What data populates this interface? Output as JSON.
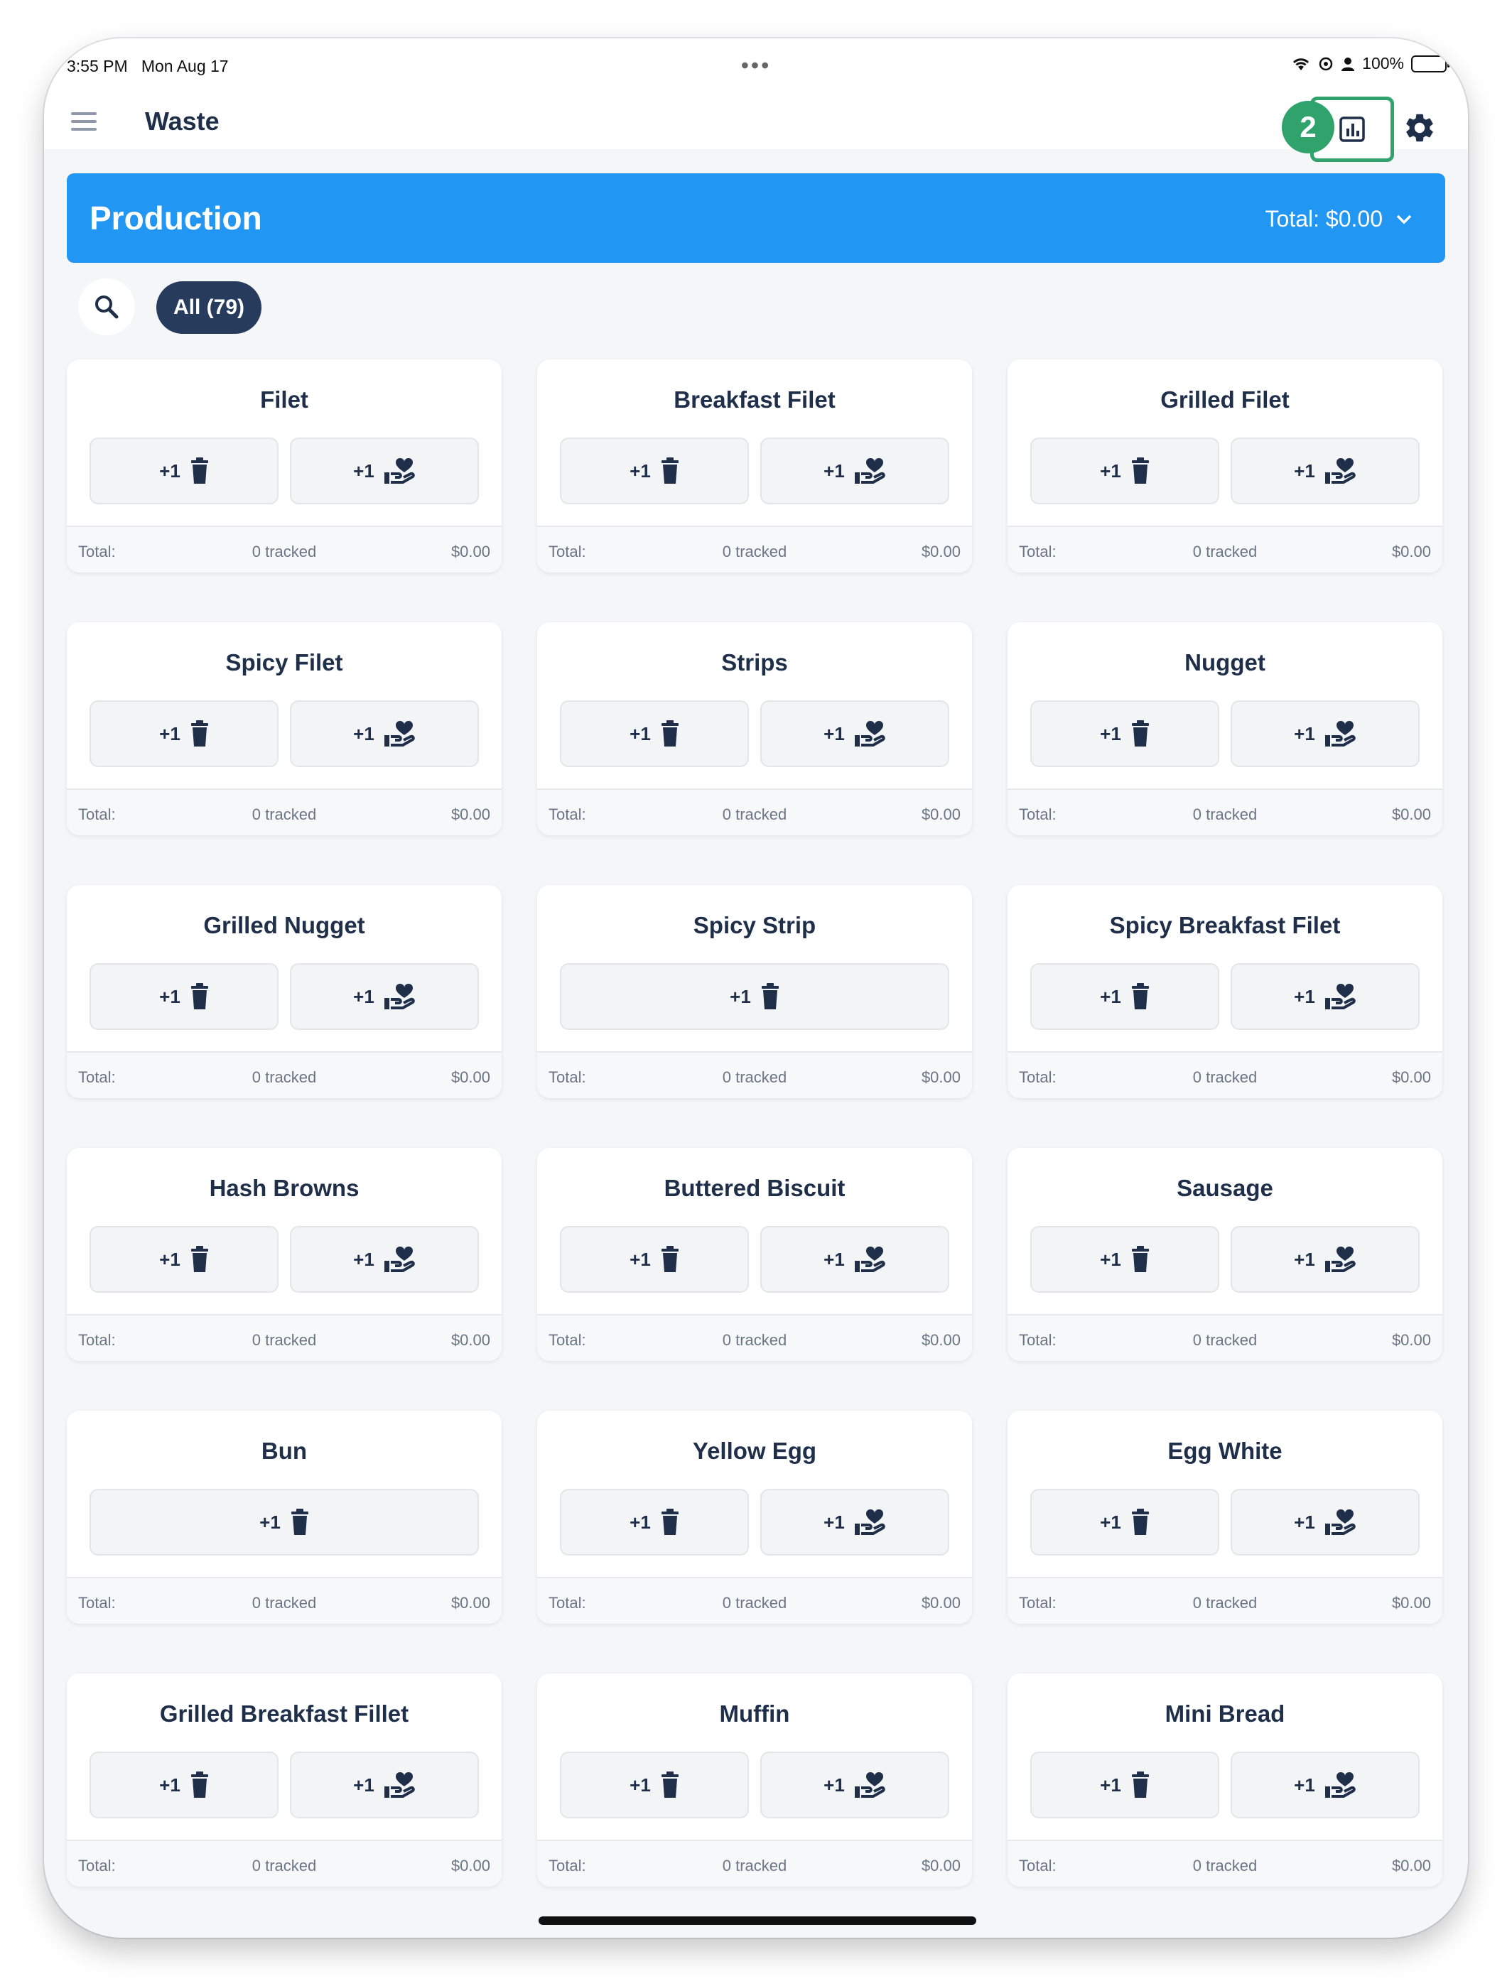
{
  "status_bar": {
    "time": "3:55 PM",
    "date": "Mon Aug 17",
    "battery": "100%",
    "dots": "•••"
  },
  "header": {
    "title": "Waste",
    "badge": "2"
  },
  "banner": {
    "label": "Production",
    "total": "Total: $0.00"
  },
  "filter": {
    "chip": "All (79)"
  },
  "labels": {
    "plus": "+1",
    "total": "Total:",
    "tracked": "0 tracked",
    "amount": "$0.00"
  },
  "colors": {
    "accent": "#2196f3",
    "highlight": "#2fa36b",
    "chip": "#273c5c"
  },
  "items": [
    {
      "name": "Filet",
      "donate": true
    },
    {
      "name": "Breakfast Filet",
      "donate": true
    },
    {
      "name": "Grilled Filet",
      "donate": true
    },
    {
      "name": "Spicy Filet",
      "donate": true
    },
    {
      "name": "Strips",
      "donate": true
    },
    {
      "name": "Nugget",
      "donate": true
    },
    {
      "name": "Grilled Nugget",
      "donate": true
    },
    {
      "name": "Spicy Strip",
      "donate": false
    },
    {
      "name": "Spicy Breakfast Filet",
      "donate": true
    },
    {
      "name": "Hash Browns",
      "donate": true
    },
    {
      "name": "Buttered Biscuit",
      "donate": true
    },
    {
      "name": "Sausage",
      "donate": true
    },
    {
      "name": "Bun",
      "donate": false
    },
    {
      "name": "Yellow Egg",
      "donate": true
    },
    {
      "name": "Egg White",
      "donate": true
    },
    {
      "name": "Grilled Breakfast Fillet",
      "donate": true
    },
    {
      "name": "Muffin",
      "donate": true
    },
    {
      "name": "Mini Bread",
      "donate": true
    }
  ]
}
